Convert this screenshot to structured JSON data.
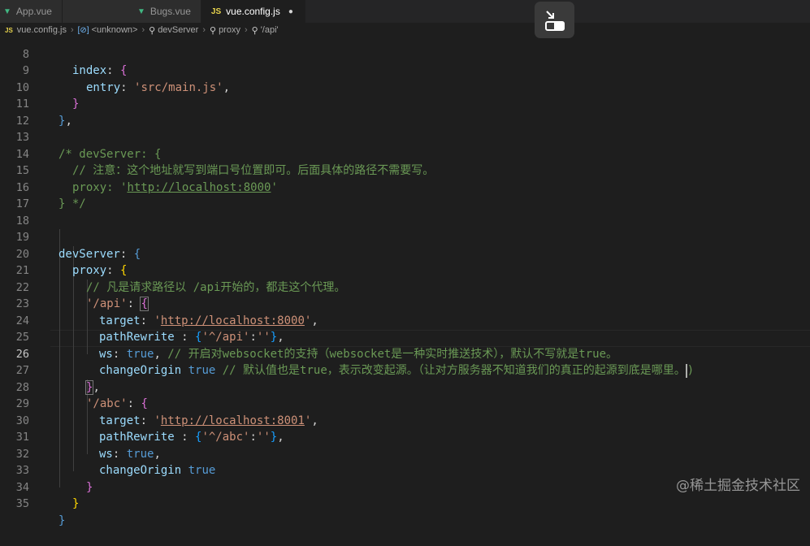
{
  "tabs": [
    {
      "label": "App.vue",
      "icon": "vue-icon"
    },
    {
      "label": "Bugs.vue",
      "icon": "vue-icon"
    },
    {
      "label": "vue.config.js",
      "icon": "js-icon",
      "active": true,
      "dirty": true
    }
  ],
  "breadcrumb": {
    "file": "vue.config.js",
    "obj": "<unknown>",
    "k1": "devServer",
    "k2": "proxy",
    "k3": "'/api'"
  },
  "editor": {
    "lines": [
      {
        "n": "8"
      },
      {
        "n": "9"
      },
      {
        "n": "10"
      },
      {
        "n": "11"
      },
      {
        "n": "12"
      },
      {
        "n": "13"
      },
      {
        "n": "14"
      },
      {
        "n": "15"
      },
      {
        "n": "16"
      },
      {
        "n": "17"
      },
      {
        "n": "18"
      },
      {
        "n": "19"
      },
      {
        "n": "20"
      },
      {
        "n": "21"
      },
      {
        "n": "22"
      },
      {
        "n": "23"
      },
      {
        "n": "24"
      },
      {
        "n": "25"
      },
      {
        "n": "26"
      },
      {
        "n": "27"
      },
      {
        "n": "28"
      },
      {
        "n": "29"
      },
      {
        "n": "30"
      },
      {
        "n": "31"
      },
      {
        "n": "32"
      },
      {
        "n": "33"
      },
      {
        "n": "34"
      },
      {
        "n": "35"
      }
    ],
    "t": {
      "index": "index",
      "entry": "entry",
      "mainjs": "'src/main.js'",
      "cmt_open": "/* devServer: {",
      "cmt_note": "// 注意：这个地址就写到端口号位置即可。后面具体的路径不需要写。",
      "cmt_proxy": "proxy: '",
      "cmt_url": "http://localhost:8000",
      "cmt_q": "'",
      "cmt_close": "} */",
      "devServer": "devServer",
      "proxy": "proxy",
      "cmt21": "// 凡是请求路径以 /api开始的，都走这个代理。",
      "api": "'/api'",
      "abc": "'/abc'",
      "target": "target",
      "url8000": "http://localhost:8000",
      "url8001": "http://localhost:8001",
      "pathRewrite": "pathRewrite",
      "re_api": "'^/api'",
      "re_abc": "'^/abc'",
      "empty": "''",
      "ws": "ws",
      "true": "true",
      "cmt25": "// 开启对websocket的支持（websocket是一种实时推送技术），默认不写就是true。",
      "changeOrigin": "changeOrigin",
      "cmt26": "// 默认值也是true，表示改变起源。（让对方服务器不知道我们的真正的起源到底是哪里。"
    }
  },
  "watermark": "@稀土掘金技术社区",
  "colors": {
    "editor_bg": "#1e1e1e",
    "keyword": "#569cd6",
    "property": "#9cdcfe",
    "string": "#ce9178",
    "comment": "#6a9955"
  }
}
